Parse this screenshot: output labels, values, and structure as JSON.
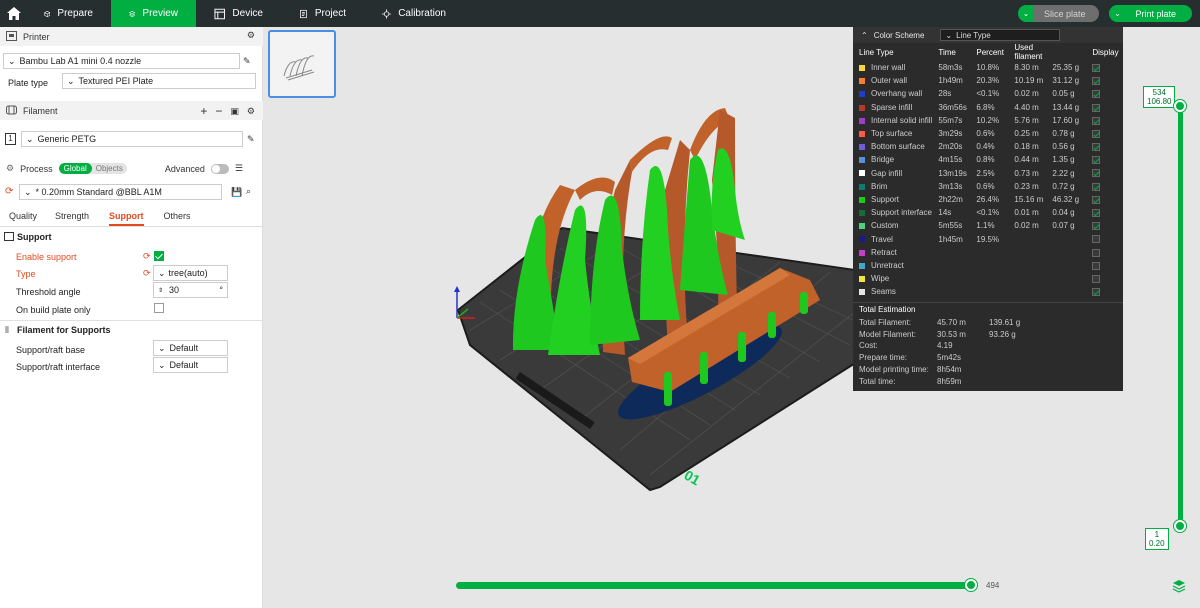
{
  "topbar": {
    "tabs": [
      {
        "label": "Prepare",
        "icon": "cube-icon"
      },
      {
        "label": "Preview",
        "icon": "layers-icon"
      },
      {
        "label": "Device",
        "icon": "device-icon"
      },
      {
        "label": "Project",
        "icon": "project-icon"
      },
      {
        "label": "Calibration",
        "icon": "calibration-icon"
      }
    ],
    "slice_label": "Slice plate",
    "print_label": "Print plate"
  },
  "printer": {
    "header": "Printer",
    "name": "Bambu Lab A1 mini 0.4 nozzle",
    "plate_type_label": "Plate type",
    "plate_type": "Textured PEI Plate"
  },
  "filament": {
    "header": "Filament",
    "slot": "1",
    "name": "Generic PETG"
  },
  "process": {
    "header": "Process",
    "global": "Global",
    "objects": "Objects",
    "advanced": "Advanced",
    "preset": "* 0.20mm Standard @BBL A1M",
    "tabs": [
      "Quality",
      "Strength",
      "Support",
      "Others"
    ]
  },
  "support": {
    "header": "Support",
    "enable_label": "Enable support",
    "type_label": "Type",
    "type_value": "tree(auto)",
    "threshold_label": "Threshold angle",
    "threshold_value": "30",
    "threshold_unit": "°",
    "build_plate_label": "On build plate only",
    "filament_header": "Filament for Supports",
    "raft_base_label": "Support/raft base",
    "raft_base_value": "Default",
    "raft_iface_label": "Support/raft interface",
    "raft_iface_value": "Default"
  },
  "legend": {
    "title": "Color Scheme",
    "scheme": "Line Type",
    "columns": [
      "Line Type",
      "Time",
      "Percent",
      "Used filament",
      "",
      "Display"
    ],
    "rows": [
      {
        "name": "Inner wall",
        "color": "#f5d63d",
        "time": "58m3s",
        "pct": "10.8%",
        "len": "8.30 m",
        "wt": "25.35 g",
        "on": true
      },
      {
        "name": "Outer wall",
        "color": "#ff7c2e",
        "time": "1h49m",
        "pct": "20.3%",
        "len": "10.19 m",
        "wt": "31.12 g",
        "on": true
      },
      {
        "name": "Overhang wall",
        "color": "#1e3ccb",
        "time": "28s",
        "pct": "<0.1%",
        "len": "0.02 m",
        "wt": "0.05 g",
        "on": true
      },
      {
        "name": "Sparse infill",
        "color": "#b23a2a",
        "time": "36m56s",
        "pct": "6.8%",
        "len": "4.40 m",
        "wt": "13.44 g",
        "on": true
      },
      {
        "name": "Internal solid infill",
        "color": "#9d3dc8",
        "time": "55m7s",
        "pct": "10.2%",
        "len": "5.76 m",
        "wt": "17.60 g",
        "on": true
      },
      {
        "name": "Top surface",
        "color": "#ff5a44",
        "time": "3m29s",
        "pct": "0.6%",
        "len": "0.25 m",
        "wt": "0.78 g",
        "on": true
      },
      {
        "name": "Bottom surface",
        "color": "#6b5ed8",
        "time": "2m20s",
        "pct": "0.4%",
        "len": "0.18 m",
        "wt": "0.56 g",
        "on": true
      },
      {
        "name": "Bridge",
        "color": "#5a8fd6",
        "time": "4m15s",
        "pct": "0.8%",
        "len": "0.44 m",
        "wt": "1.35 g",
        "on": true
      },
      {
        "name": "Gap infill",
        "color": "#ffffff",
        "time": "13m19s",
        "pct": "2.5%",
        "len": "0.73 m",
        "wt": "2.22 g",
        "on": true
      },
      {
        "name": "Brim",
        "color": "#0d7a6e",
        "time": "3m13s",
        "pct": "0.6%",
        "len": "0.23 m",
        "wt": "0.72 g",
        "on": true
      },
      {
        "name": "Support",
        "color": "#1ec81e",
        "time": "2h22m",
        "pct": "26.4%",
        "len": "15.16 m",
        "wt": "46.32 g",
        "on": true
      },
      {
        "name": "Support interface",
        "color": "#1a6b3a",
        "time": "14s",
        "pct": "<0.1%",
        "len": "0.01 m",
        "wt": "0.04 g",
        "on": true
      },
      {
        "name": "Custom",
        "color": "#4ed282",
        "time": "5m55s",
        "pct": "1.1%",
        "len": "0.02 m",
        "wt": "0.07 g",
        "on": true
      },
      {
        "name": "Travel",
        "color": "#1a1a8a",
        "time": "1h45m",
        "pct": "19.5%",
        "len": "",
        "wt": "",
        "on": false
      },
      {
        "name": "Retract",
        "color": "#c83cc8",
        "time": "",
        "pct": "",
        "len": "",
        "wt": "",
        "on": false
      },
      {
        "name": "Unretract",
        "color": "#3caac8",
        "time": "",
        "pct": "",
        "len": "",
        "wt": "",
        "on": false
      },
      {
        "name": "Wipe",
        "color": "#f0e63c",
        "time": "",
        "pct": "",
        "len": "",
        "wt": "",
        "on": false
      },
      {
        "name": "Seams",
        "color": "#e6e6e6",
        "time": "",
        "pct": "",
        "len": "",
        "wt": "",
        "on": true
      }
    ],
    "total_title": "Total Estimation",
    "totals": [
      {
        "k": "Total Filament:",
        "v1": "45.70 m",
        "v2": "139.61 g"
      },
      {
        "k": "Model Filament:",
        "v1": "30.53 m",
        "v2": "93.26 g"
      },
      {
        "k": "Cost:",
        "v1": "4.19",
        "v2": ""
      },
      {
        "k": "Prepare time:",
        "v1": "5m42s",
        "v2": ""
      },
      {
        "k": "Model printing time:",
        "v1": "8h54m",
        "v2": ""
      },
      {
        "k": "Total time:",
        "v1": "8h59m",
        "v2": ""
      }
    ]
  },
  "layer_slider": {
    "top_layer": "534",
    "top_height": "106.80",
    "bottom_layer": "1",
    "bottom_height": "0.20"
  },
  "move_slider": {
    "value": "494"
  },
  "plate": {
    "number": "01"
  }
}
